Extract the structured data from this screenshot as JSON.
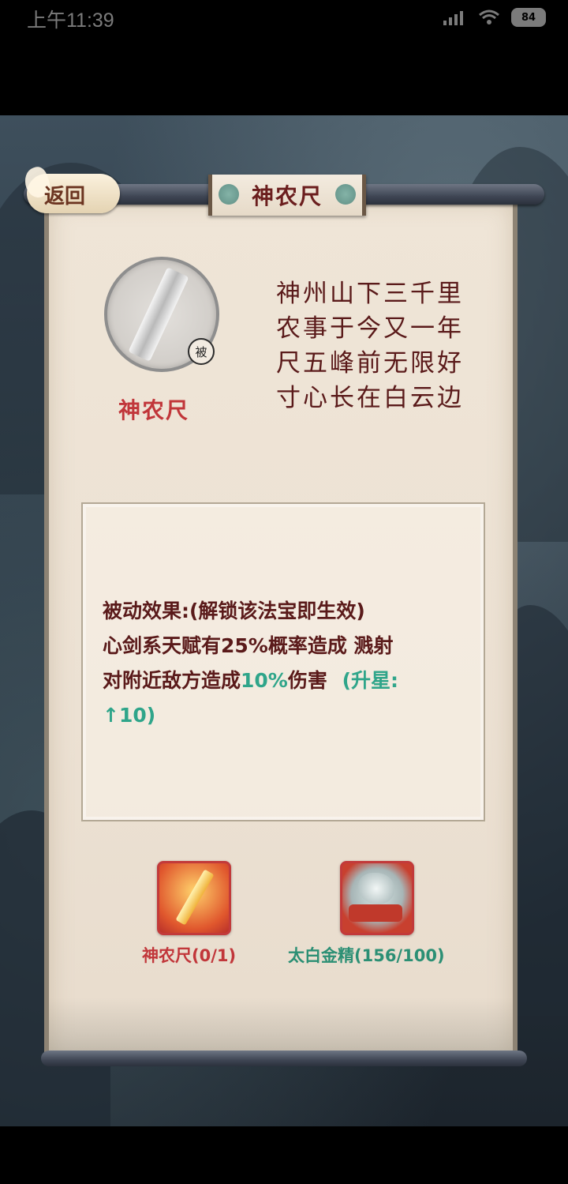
{
  "status_bar": {
    "time": "上午11:39",
    "battery": "84",
    "signal_icon": "signal-icon",
    "wifi_icon": "wifi-icon"
  },
  "header": {
    "back_label": "返回",
    "title": "神农尺"
  },
  "item": {
    "name": "神农尺",
    "badge": "被"
  },
  "poem": [
    "神州山下三千里",
    "农事于今又一年",
    "尺五峰前无限好",
    "寸心长在白云边"
  ],
  "effect": {
    "line1": "被动效果:(解锁该法宝即生效)",
    "line2": "心剑系天赋有25%概率造成 溅射",
    "line3_prefix": "对附近敌方造成",
    "line3_value": "10%",
    "line3_suffix": "伤害",
    "upgrade_text": "(升星:",
    "upgrade_value": "↑10)"
  },
  "materials": [
    {
      "label": "神农尺(0/1)",
      "icon": "shennong-ruler-icon"
    },
    {
      "label": "太白金精(156/100)",
      "icon": "taibai-gold-essence-icon"
    }
  ],
  "colors": {
    "title_red": "#c1363a",
    "ink": "#5a1a1a",
    "green": "#2fa58a"
  }
}
